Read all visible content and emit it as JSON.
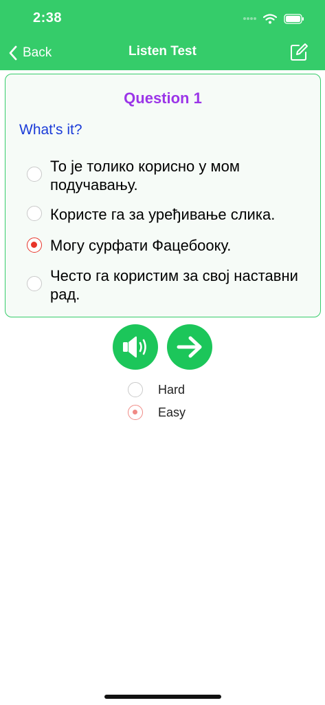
{
  "status_bar": {
    "time": "2:38",
    "icons": [
      "signal-icon",
      "wifi-icon",
      "battery-icon"
    ]
  },
  "nav": {
    "back_label": "Back",
    "title": "Listen Test",
    "edit_icon": "edit-icon"
  },
  "question": {
    "title": "Question 1",
    "prompt": "What's it?",
    "options": [
      {
        "text": "То је толико корисно у мом подучавању.",
        "selected": false
      },
      {
        "text": "Користе га за уређивање слика.",
        "selected": false
      },
      {
        "text": "Могу сурфати Фацебооку.",
        "selected": true
      },
      {
        "text": "Често га користим за свој наставни рад.",
        "selected": false
      }
    ]
  },
  "controls": {
    "speaker_icon": "speaker-icon",
    "next_icon": "arrow-right-icon"
  },
  "difficulty": {
    "options": [
      {
        "label": "Hard",
        "selected": false
      },
      {
        "label": "Easy",
        "selected": true
      }
    ]
  },
  "colors": {
    "header_bg": "#35cc6a",
    "question_title": "#9b35e8",
    "prompt": "#1a3bd8",
    "selected_radio": "#e8352a",
    "button_bg": "#1cc65a"
  }
}
